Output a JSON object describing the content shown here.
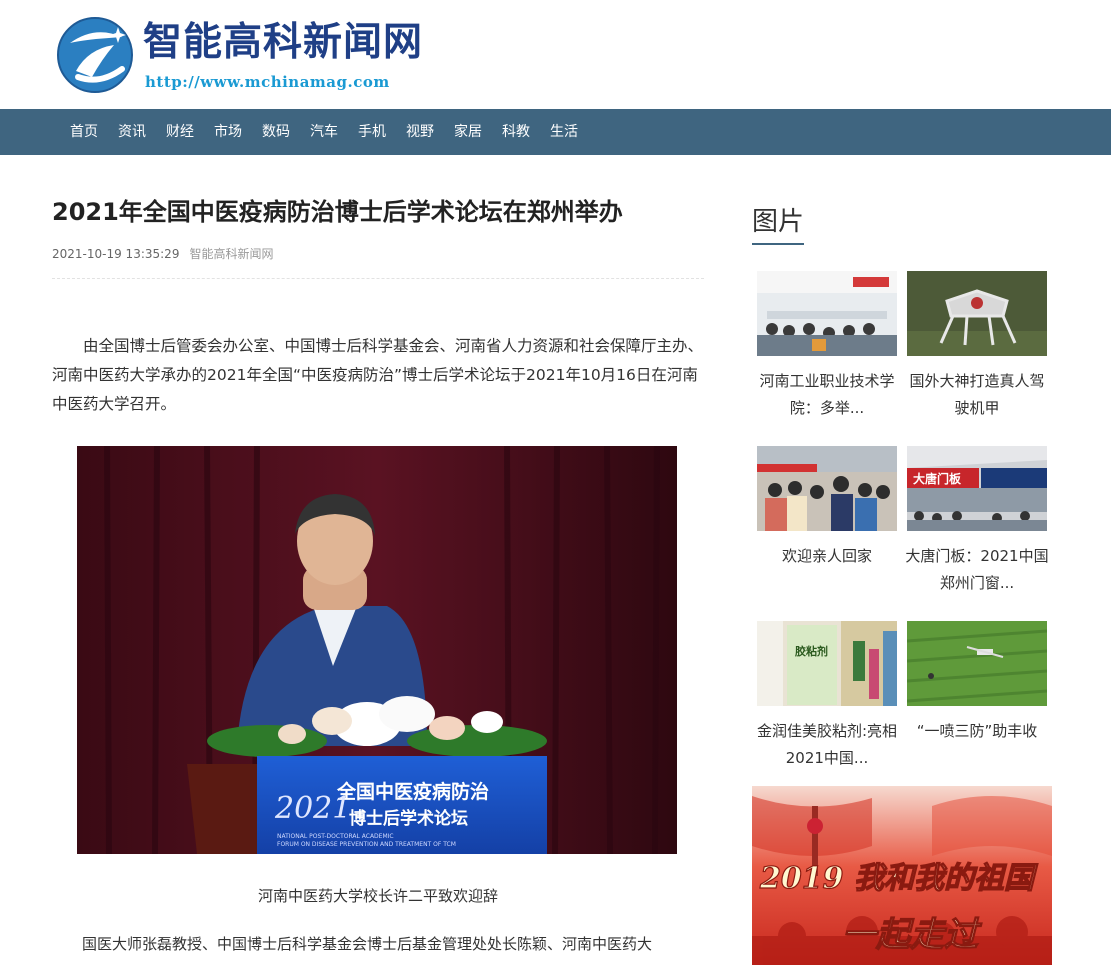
{
  "site": {
    "name": "智能高科新闻网",
    "url": "http://www.mchinamag.com"
  },
  "nav": [
    "首页",
    "资讯",
    "财经",
    "市场",
    "数码",
    "汽车",
    "手机",
    "视野",
    "家居",
    "科教",
    "生活"
  ],
  "article": {
    "title": "2021年全国中医疫病防治博士后学术论坛在郑州举办",
    "date": "2021-10-19 13:35:29",
    "source": "智能高科新闻网",
    "para1": "由全国博士后管委会办公室、中国博士后科学基金会、河南省人力资源和社会保障厅主办、河南中医药大学承办的2021年全国“中医疫病防治”博士后学术论坛于2021年10月16日在河南中医药大学召开。",
    "photo": {
      "podium_title_line1": "全国中医疫病防治",
      "podium_title_line2": "博士后学术论坛",
      "podium_year": "2021",
      "podium_english_line1": "NATIONAL POST-DOCTORAL ACADEMIC",
      "podium_english_line2": "FORUM ON DISEASE PREVENTION AND TREATMENT OF TCM"
    },
    "caption": "河南中医药大学校长许二平致欢迎辞",
    "para2": "国医大师张磊教授、中国博士后科学基金会博士后基金管理处处长陈颖、河南中医药大"
  },
  "sidebar": {
    "title": "图片",
    "items": [
      {
        "line1": "河南工业职业技术学",
        "line2": "院：多举..."
      },
      {
        "line1": "国外大神打造真人驾",
        "line2": "驶机甲"
      },
      {
        "line1": "欢迎亲人回家",
        "line2": ""
      },
      {
        "line1": "大唐门板：2021中国",
        "line2": "郑州门窗..."
      },
      {
        "line1": "金润佳美胶粘剂:亮相",
        "line2": "2021中国..."
      },
      {
        "line1": "“一喷三防”助丰收",
        "line2": ""
      }
    ],
    "thumb_texts": {
      "booth_sign": "大唐门板",
      "glue_label": "胶粘剂"
    },
    "banner": {
      "line1": "2019 我和我的祖国",
      "line2": "一起走过"
    }
  },
  "colors": {
    "nav_bg": "#3f6580",
    "brand_blue": "#1f3f86",
    "url_blue": "#1a9ad3"
  }
}
